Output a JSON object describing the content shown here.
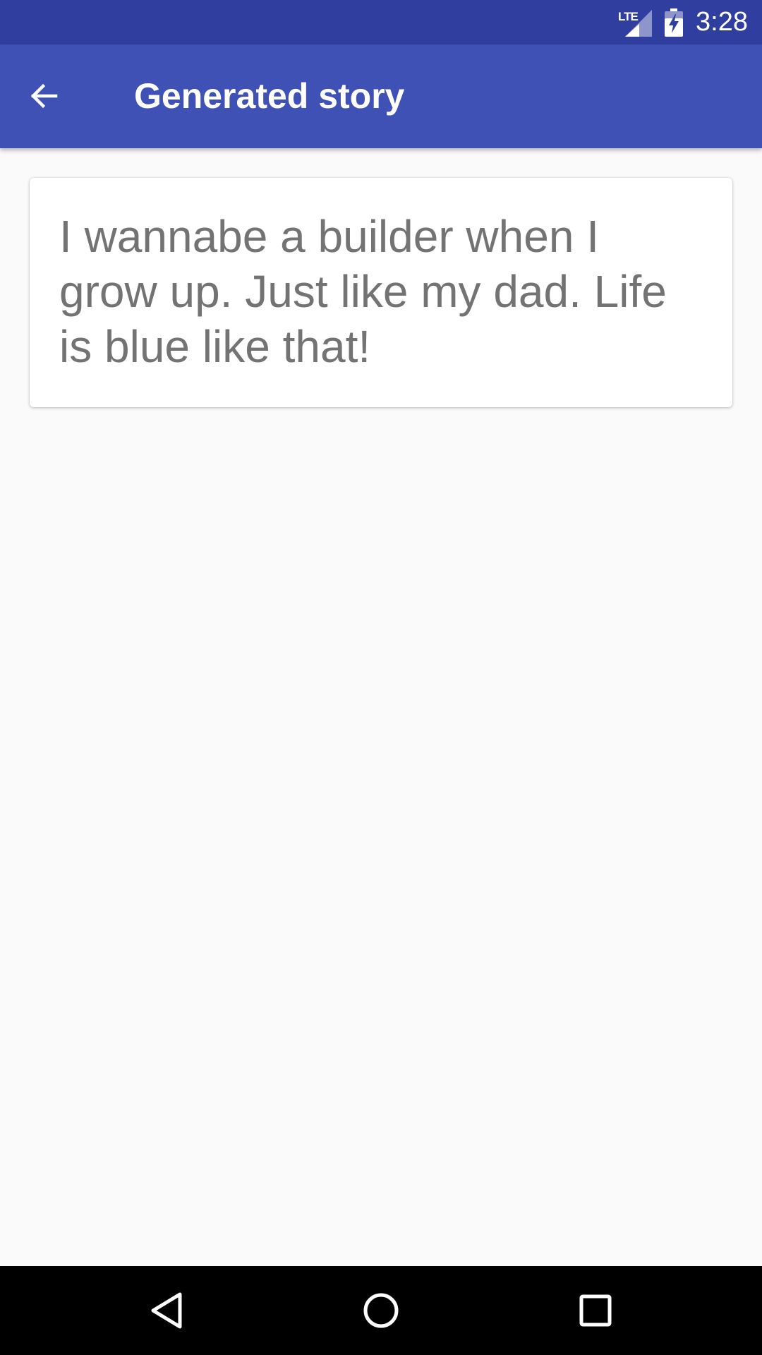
{
  "status_bar": {
    "network_label": "LTE",
    "signal_icon": "signal-icon",
    "battery_icon": "battery-charging-icon",
    "time": "3:28"
  },
  "app_bar": {
    "back_icon": "arrow-back-icon",
    "title": "Generated story",
    "background_color": "#3f51b5",
    "status_color": "#303f9f"
  },
  "story": {
    "text": "I wannabe a builder when I grow up. Just like my dad. Life is blue like that!"
  },
  "nav_bar": {
    "back_icon": "nav-back-icon",
    "home_icon": "nav-home-icon",
    "recents_icon": "nav-recents-icon"
  }
}
